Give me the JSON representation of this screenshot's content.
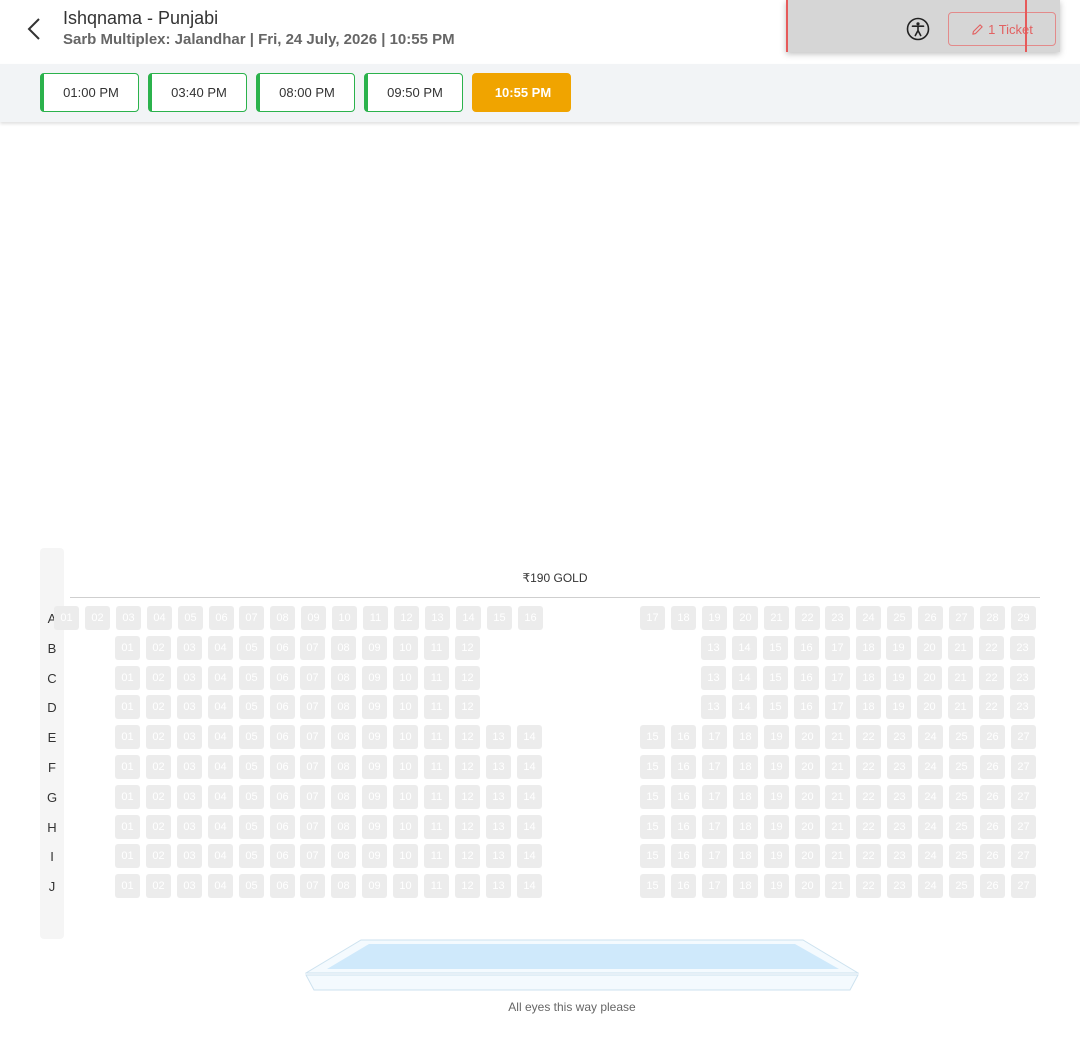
{
  "header": {
    "title": "Ishqnama - Punjabi",
    "subtitle": "Sarb Multiplex: Jalandhar | Fri, 24 July, 2026 | 10:55 PM",
    "ticket_label": "1 Ticket",
    "back_icon": "chevron-left-icon",
    "accessibility_icon": "accessibility-icon",
    "ticket_icon": "pencil-icon"
  },
  "showtimes": [
    {
      "time": "01:00 PM",
      "selected": false
    },
    {
      "time": "03:40 PM",
      "selected": false
    },
    {
      "time": "08:00 PM",
      "selected": false
    },
    {
      "time": "09:50 PM",
      "selected": false
    },
    {
      "time": "10:55 PM",
      "selected": true
    }
  ],
  "category": "₹190 GOLD",
  "rows": [
    {
      "label": "A",
      "seats": [
        "01",
        "02",
        "03",
        "04",
        "05",
        "06",
        "07",
        "08",
        "09",
        "10",
        "11",
        "12",
        "13",
        "14",
        "15",
        "16",
        "17",
        "18",
        "19",
        "20",
        "21",
        "22",
        "23",
        "24",
        "25",
        "26",
        "27",
        "28",
        "29"
      ]
    },
    {
      "label": "B",
      "seats": [
        "01",
        "02",
        "03",
        "04",
        "05",
        "06",
        "07",
        "08",
        "09",
        "10",
        "11",
        "12",
        "13",
        "14",
        "15",
        "16",
        "17",
        "18",
        "19",
        "20",
        "21",
        "22",
        "23"
      ]
    },
    {
      "label": "C",
      "seats": [
        "01",
        "02",
        "03",
        "04",
        "05",
        "06",
        "07",
        "08",
        "09",
        "10",
        "11",
        "12",
        "13",
        "14",
        "15",
        "16",
        "17",
        "18",
        "19",
        "20",
        "21",
        "22",
        "23"
      ]
    },
    {
      "label": "D",
      "seats": [
        "01",
        "02",
        "03",
        "04",
        "05",
        "06",
        "07",
        "08",
        "09",
        "10",
        "11",
        "12",
        "13",
        "14",
        "15",
        "16",
        "17",
        "18",
        "19",
        "20",
        "21",
        "22",
        "23"
      ]
    },
    {
      "label": "E",
      "seats": [
        "01",
        "02",
        "03",
        "04",
        "05",
        "06",
        "07",
        "08",
        "09",
        "10",
        "11",
        "12",
        "13",
        "14",
        "15",
        "16",
        "17",
        "18",
        "19",
        "20",
        "21",
        "22",
        "23",
        "24",
        "25",
        "26",
        "27"
      ]
    },
    {
      "label": "F",
      "seats": [
        "01",
        "02",
        "03",
        "04",
        "05",
        "06",
        "07",
        "08",
        "09",
        "10",
        "11",
        "12",
        "13",
        "14",
        "15",
        "16",
        "17",
        "18",
        "19",
        "20",
        "21",
        "22",
        "23",
        "24",
        "25",
        "26",
        "27"
      ]
    },
    {
      "label": "G",
      "seats": [
        "01",
        "02",
        "03",
        "04",
        "05",
        "06",
        "07",
        "08",
        "09",
        "10",
        "11",
        "12",
        "13",
        "14",
        "15",
        "16",
        "17",
        "18",
        "19",
        "20",
        "21",
        "22",
        "23",
        "24",
        "25",
        "26",
        "27"
      ]
    },
    {
      "label": "H",
      "seats": [
        "01",
        "02",
        "03",
        "04",
        "05",
        "06",
        "07",
        "08",
        "09",
        "10",
        "11",
        "12",
        "13",
        "14",
        "15",
        "16",
        "17",
        "18",
        "19",
        "20",
        "21",
        "22",
        "23",
        "24",
        "25",
        "26",
        "27"
      ]
    },
    {
      "label": "I",
      "seats": [
        "01",
        "02",
        "03",
        "04",
        "05",
        "06",
        "07",
        "08",
        "09",
        "10",
        "11",
        "12",
        "13",
        "14",
        "15",
        "16",
        "17",
        "18",
        "19",
        "20",
        "21",
        "22",
        "23",
        "24",
        "25",
        "26",
        "27"
      ]
    },
    {
      "label": "J",
      "seats": [
        "01",
        "02",
        "03",
        "04",
        "05",
        "06",
        "07",
        "08",
        "09",
        "10",
        "11",
        "12",
        "13",
        "14",
        "15",
        "16",
        "17",
        "18",
        "19",
        "20",
        "21",
        "22",
        "23",
        "24",
        "25",
        "26",
        "27"
      ]
    }
  ],
  "screen_caption": "All eyes this way please",
  "colors": {
    "accent_selected": "#f0a400",
    "available_border": "#2bb24c",
    "seat_unavailable": "#ececec",
    "ticket_button": "#e26161",
    "screen": "#cfe9fb"
  }
}
